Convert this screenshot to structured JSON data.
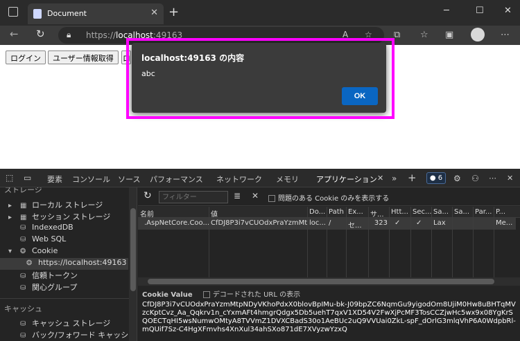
{
  "browser": {
    "tab_title": "Document",
    "address": {
      "scheme": "https://",
      "host": "localhost",
      "port": ":49163"
    }
  },
  "page": {
    "buttons": [
      "ログイン",
      "ユーザー情報取得",
      "ロ"
    ]
  },
  "dialog": {
    "title": "localhost:49163 の内容",
    "message": "abc",
    "ok_label": "OK"
  },
  "devtools": {
    "tabs": [
      "要素",
      "コンソール",
      "ソース",
      "パフォーマンス",
      "ネットワーク",
      "メモリ",
      "アプリケーション"
    ],
    "issues_count": "6",
    "sidebar": {
      "storage_heading": "ストレージ",
      "items": [
        "ローカル ストレージ",
        "セッション ストレージ",
        "IndexedDB",
        "Web SQL",
        "Cookie",
        "https://localhost:49163",
        "信頼トークン",
        "関心グループ"
      ],
      "cache_heading": "キャッシュ",
      "cache_items": [
        "キャッシュ ストレージ",
        "バック/フォワード キャッシュ"
      ]
    },
    "toolbar": {
      "filter_placeholder": "フィルター",
      "problem_cookie_label": "問題のある Cookie のみを表示する"
    },
    "table": {
      "columns": [
        "名前",
        "値",
        "Do...",
        "Path",
        "Ex...",
        "サ...",
        "Htt...",
        "Sec...",
        "Sa...",
        "Sa...",
        "Par...",
        "P..."
      ],
      "row": [
        ".AspNetCore.Coo...",
        "CfDJ8P3i7vCUOdxPraYzmMt...",
        "loc...",
        "/",
        "セ...",
        "323",
        "✓",
        "✓",
        "Lax",
        "",
        "",
        "Me..."
      ]
    },
    "cookie_value": {
      "label": "Cookie Value",
      "decode_label": "デコードされた URL の表示",
      "text": "CfDJ8P3i7vCUOdxPraYzmMtpNDyVKhoPdxX0blovBpIMu-bk-J09bpZC6NqmGu9yigodOm8UjiM0Hw8uBHTqMVzcKptCvz_Aa_Qqkrv1n_cYxmAFt4hmgrQdgx5Db5uehT7qxV1XD54V2FwXjPcMF3TosCCZjwHc5wx9x08YgKrSQOECTqHI5wsNumwOMtyA8TVVmZ1DVXCBadS30o1AeBUc2uQ9VVUai0ZkL-spF_dOrlG3mlqVhP6A0WdpbRl-mQUif7Sz-C4HgXFmvhs4XnXul34ahSXo871dE7XVyzwYzxQ"
    }
  }
}
